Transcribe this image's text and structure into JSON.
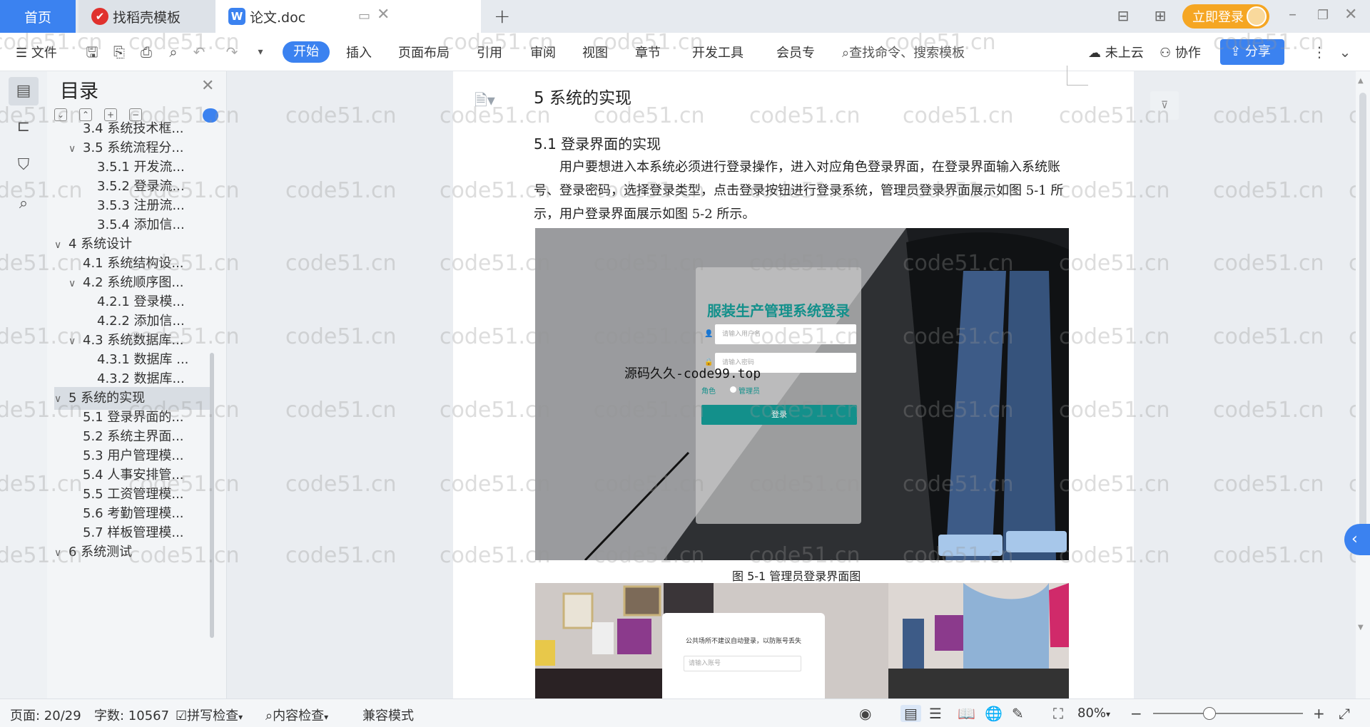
{
  "tabs": {
    "home": "首页",
    "templates": "找稻壳模板",
    "doc": "论文.doc"
  },
  "topright": {
    "login": "立即登录"
  },
  "ribbon": {
    "file": "文件",
    "menus": [
      "开始",
      "插入",
      "页面布局",
      "引用",
      "审阅",
      "视图",
      "章节",
      "开发工具",
      "会员专"
    ],
    "search_placeholder": "查找命令、搜索模板",
    "cloud": "未上云",
    "collab": "协作",
    "share": "分享"
  },
  "toc": {
    "title": "目录",
    "items": [
      {
        "label": "3.4  系统技术框...",
        "level": 2,
        "arrow": ""
      },
      {
        "label": "3.5  系统流程分...",
        "level": 2,
        "arrow": "∨"
      },
      {
        "label": "3.5.1  开发流...",
        "level": 3,
        "arrow": ""
      },
      {
        "label": "3.5.2  登录流...",
        "level": 3,
        "arrow": ""
      },
      {
        "label": "3.5.3  注册流...",
        "level": 3,
        "arrow": ""
      },
      {
        "label": "3.5.4  添加信...",
        "level": 3,
        "arrow": ""
      },
      {
        "label": "4    系统设计",
        "level": 1,
        "arrow": "∨"
      },
      {
        "label": "4.1  系统结构设...",
        "level": 2,
        "arrow": ""
      },
      {
        "label": "4.2  系统顺序图...",
        "level": 2,
        "arrow": "∨"
      },
      {
        "label": "4.2.1  登录模...",
        "level": 3,
        "arrow": ""
      },
      {
        "label": "4.2.2  添加信...",
        "level": 3,
        "arrow": ""
      },
      {
        "label": "4.3  系统数据库...",
        "level": 2,
        "arrow": "∨"
      },
      {
        "label": "4.3.1  数据库 ...",
        "level": 3,
        "arrow": ""
      },
      {
        "label": "4.3.2  数据库...",
        "level": 3,
        "arrow": ""
      },
      {
        "label": "5    系统的实现",
        "level": 1,
        "arrow": "∨",
        "active": true
      },
      {
        "label": "5.1  登录界面的...",
        "level": 2,
        "arrow": ""
      },
      {
        "label": "5.2  系统主界面...",
        "level": 2,
        "arrow": ""
      },
      {
        "label": "5.3  用户管理模...",
        "level": 2,
        "arrow": ""
      },
      {
        "label": "5.4  人事安排管...",
        "level": 2,
        "arrow": ""
      },
      {
        "label": "5.5  工资管理模...",
        "level": 2,
        "arrow": ""
      },
      {
        "label": "5.6  考勤管理模...",
        "level": 2,
        "arrow": ""
      },
      {
        "label": "5.7  样板管理模...",
        "level": 2,
        "arrow": ""
      },
      {
        "label": "6    系统测试",
        "level": 1,
        "arrow": "∨"
      }
    ]
  },
  "doc": {
    "h1": "5   系统的实现",
    "h2": "5.1  登录界面的实现",
    "para": "用户要想进入本系统必须进行登录操作，进入对应角色登录界面，在登录界面输入系统账号、登录密码，选择登录类型，点击登录按钮进行登录系统，管理员登录界面展示如图 5-1 所示，用户登录界面展示如图 5-2 所示。",
    "fig1": {
      "title": "服装生产管理系统登录",
      "user_placeholder": "请输入用户名",
      "pwd_placeholder": "请输入密码",
      "role_label": "角色",
      "role_option": "管理员",
      "login": "登录"
    },
    "fig1_caption": "图 5-1    管理员登录界面图",
    "fig2": {
      "notice": "公共场所不建议自动登录，以防账号丢失",
      "account_placeholder": "请输入账号"
    },
    "overlay": "源码久久-code99.top",
    "watermark": "code51.cn"
  },
  "status": {
    "page": "页面: 20/29",
    "words": "字数: 10567",
    "spell": "拼写检查",
    "content": "内容检查",
    "compat": "兼容模式",
    "zoom": "80%"
  }
}
